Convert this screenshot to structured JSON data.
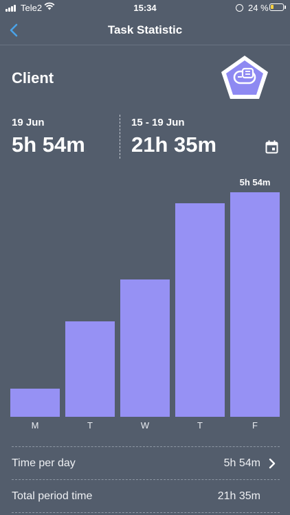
{
  "status_bar": {
    "carrier": "Tele2",
    "time": "15:34",
    "battery": "24 %",
    "battery_level": 0.24,
    "battery_color": "#f5d042"
  },
  "nav": {
    "title": "Task Statistic",
    "back_icon": "chevron-left-icon",
    "accent": "#4aa3e8"
  },
  "header": {
    "title": "Client",
    "badge_icon": "client-hand-icon"
  },
  "stats": {
    "day": {
      "date": "19 Jun",
      "value": "5h 54m"
    },
    "period": {
      "date": "15 - 19 Jun",
      "value": "21h 35m"
    },
    "calendar_icon": "calendar-icon"
  },
  "chart_data": {
    "type": "bar",
    "categories": [
      "M",
      "T",
      "W",
      "T",
      "F"
    ],
    "values": [
      0.73,
      2.5,
      3.6,
      5.6,
      5.9
    ],
    "value_unit": "hours",
    "data_labels": [
      null,
      null,
      null,
      null,
      "5h 54m"
    ],
    "bar_color": "#9691f4"
  },
  "rows": {
    "time_per_day": {
      "label": "Time per day",
      "value": "5h 54m"
    },
    "total_period": {
      "label": "Total period time",
      "value": "21h 35m"
    }
  }
}
